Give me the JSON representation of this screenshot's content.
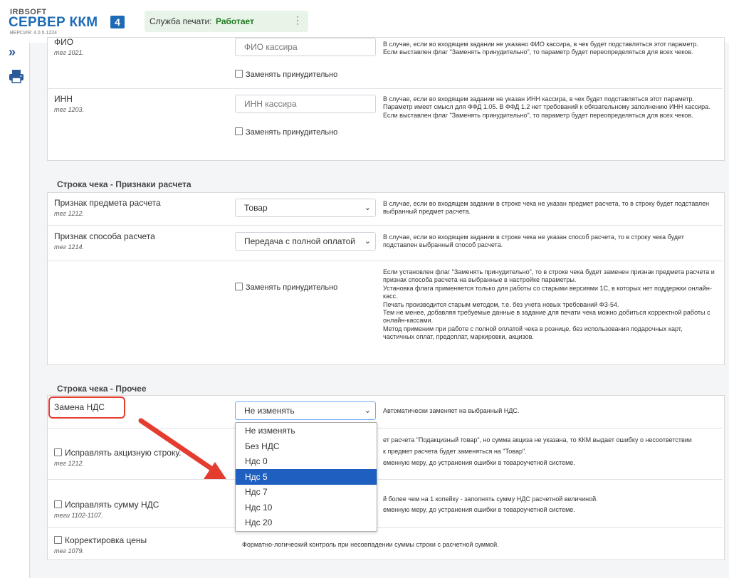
{
  "header": {
    "logo_brand": "IRBSOFT",
    "logo_title": "СЕРВЕР ККМ",
    "logo_badge": "4",
    "version": "ВЕРСИЯ: 4.0.5.1224",
    "print_service_label": "Служба печати:",
    "print_service_status": "Работает",
    "menu_glyph": "⋮"
  },
  "sidebar": {
    "expand_glyph": "»",
    "icons": [
      "expand-icon",
      "printer-icon"
    ]
  },
  "cashier": {
    "fio": {
      "label": "ФИО",
      "tag": "тег 1021.",
      "placeholder": "ФИО кассира",
      "force_label": "Заменять принудительно",
      "desc": [
        "В случае, если во входящем задании не указано ФИО кассира, в чек будет подставляться этот параметр.",
        "Если выставлен флаг \"Заменять принудительно\", то параметр будет переопределяться для всех чеков."
      ]
    },
    "inn": {
      "label": "ИНН",
      "tag": "тег 1203.",
      "placeholder": "ИНН кассира",
      "force_label": "Заменять принудительно",
      "desc": [
        "В случае, если во входящем задании не указан ИНН кассира, в чек будет подставляться этот параметр.",
        "Параметр имеет смысл для ФФД 1.05. В ФФД 1.2 нет требований к обязательному заполнению ИНН кассира.",
        "Если выставлен флаг \"Заменять принудительно\", то параметр будет переопределяться для всех чеков."
      ]
    }
  },
  "section_payment": {
    "title": "Строка чека - Признаки расчета",
    "subject": {
      "label": "Признак предмета расчета",
      "tag": "тег 1212.",
      "value": "Товар",
      "desc": "В случае, если во входящем задании в строке чека не указан предмет расчета, то в строку будет подставлен выбранный предмет расчета."
    },
    "method": {
      "label": "Признак способа расчета",
      "tag": "тег 1214.",
      "value": "Передача с полной оплатой",
      "desc": "В случае, если во входящем задании в строке чека не указан способ расчета, то в строку чека будет подставлен выбранный способ расчета."
    },
    "force": {
      "label": "Заменять принудительно",
      "desc": [
        "Если установлен флаг \"Заменять принудительно\", то в строке чека будет заменен признак предмета расчета и признак способа расчета на выбранные в настройке параметры.",
        "Установка флага применяется только для работы со старыми версиями 1С, в которых нет поддержки онлайн-касс.",
        "Печать производится старым методом, т.е. без учета новых требований ФЗ-54.",
        "Тем не менее, добавляя требуемые данные в задание для печати чека можно добиться корректной работы с онлайн-кассами.",
        "Метод применим при работе с полной оплатой чека в рознице, без использования подарочных карт, частичных оплат, предоплат, маркировки, акцизов."
      ]
    }
  },
  "section_other": {
    "title": "Строка чека - Прочее",
    "vat": {
      "label": "Замена НДС",
      "value": "Не изменять",
      "desc": "Автоматически заменяет на выбранный НДС.",
      "options": [
        "Не изменять",
        "Без НДС",
        "Ндс 0",
        "Ндс 5",
        "Ндс 7",
        "Ндс 10",
        "Ндс 20"
      ],
      "highlighted_option": "Ндс 5"
    },
    "excise": {
      "label": "Исправлять акцизную строку.",
      "tag": "тег 1212.",
      "desc": [
        "ет расчета \"Подакцизный товар\", но сумма акциза не указана, то ККМ выдает ошибку о несоответствии",
        "к предмет расчета будет заменяться на \"Товар\".",
        "еменную меру, до устранения ошибки в товароучетной системе."
      ]
    },
    "vat_sum": {
      "label": "Исправлять сумму НДС",
      "tag": "теги 1102-1107.",
      "desc": [
        "й более чем на 1 копейку - заполнять сумму НДС расчетной величиной.",
        "еменную меру, до устранения ошибки в товароучетной системе."
      ]
    },
    "price": {
      "label": "Корректировка цены",
      "tag": "тег 1079.",
      "desc": "Форматно-логический контроль при несовпадении суммы строки с расчетной суммой."
    }
  },
  "colors": {
    "accent": "#1d6bb6",
    "status_ok": "#1f7a1f",
    "highlight": "#1f5fbf",
    "annotation": "#e43d30"
  }
}
